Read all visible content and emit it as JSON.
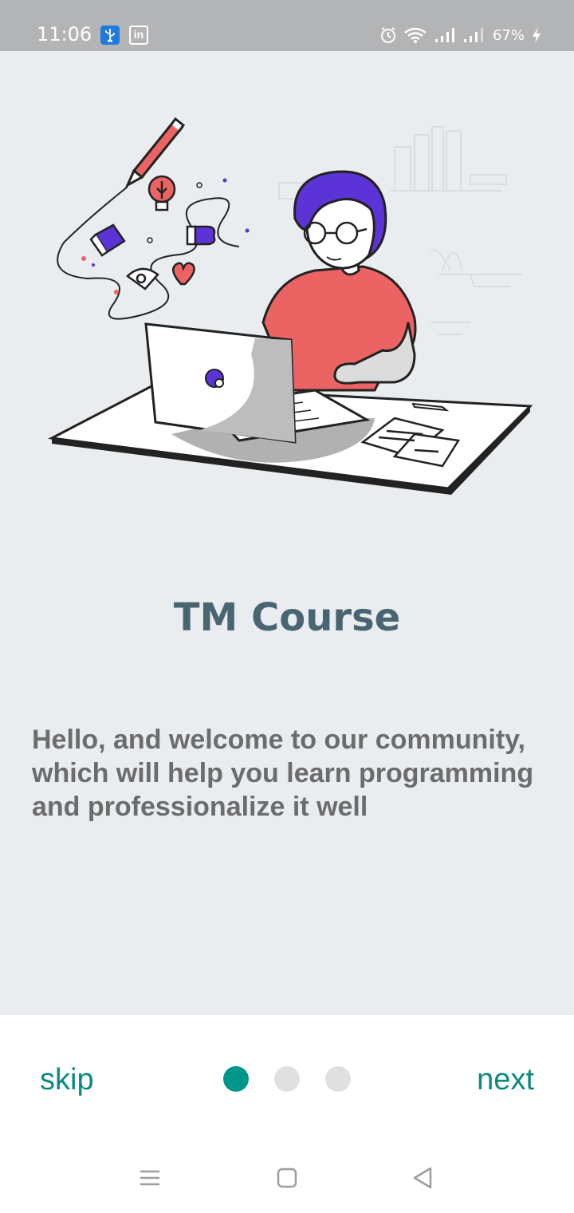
{
  "status_bar": {
    "time": "11:06",
    "battery": "67%",
    "icons": [
      "usb-debug-icon",
      "linkedin-icon",
      "alarm-icon",
      "wifi-icon",
      "signal-icon",
      "signal-icon-2",
      "charging-icon"
    ]
  },
  "onboarding": {
    "title": "TM Course",
    "description": "Hello, and welcome to our community, which will help you learn programming and professionalize it well",
    "illustration": "person-at-laptop-illustration"
  },
  "footer": {
    "skip_label": "skip",
    "next_label": "next",
    "page_count": 3,
    "current_page": 1
  },
  "navigation_bar": {
    "icons": [
      "menu-icon",
      "home-icon",
      "back-icon"
    ]
  },
  "colors": {
    "accent": "#00968a",
    "title": "#4a6572",
    "description": "#6c6c6c",
    "background": "#e9edf0",
    "status_bar": "#b3b4b6"
  }
}
